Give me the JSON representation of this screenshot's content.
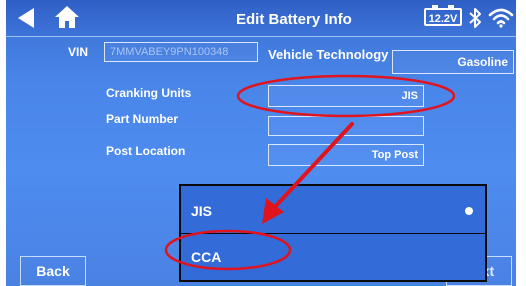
{
  "header": {
    "title": "Edit Battery Info",
    "battery_badge": "12.2V",
    "icons": [
      "back-arrow-icon",
      "home-icon",
      "battery-icon",
      "bluetooth-icon",
      "wifi-icon"
    ]
  },
  "form": {
    "vin_label": "VIN",
    "vin_value": "7MMVABEY9PN100348",
    "vehicle_technology_label": "Vehicle Technology",
    "vehicle_technology_value": "Gasoline",
    "cranking_units_label": "Cranking Units",
    "cranking_units_value": "JIS",
    "part_number_label": "Part Number",
    "part_number_value": "",
    "post_location_label": "Post Location",
    "post_location_value": "Top Post"
  },
  "dropdown": {
    "options": [
      {
        "label": "JIS",
        "selected": true
      },
      {
        "label": "CCA",
        "selected": false
      }
    ]
  },
  "footer": {
    "back_label": "Back",
    "next_label": "Next"
  },
  "annotation_color": "#e0141e",
  "popup_border_color": "#0a0a0a"
}
